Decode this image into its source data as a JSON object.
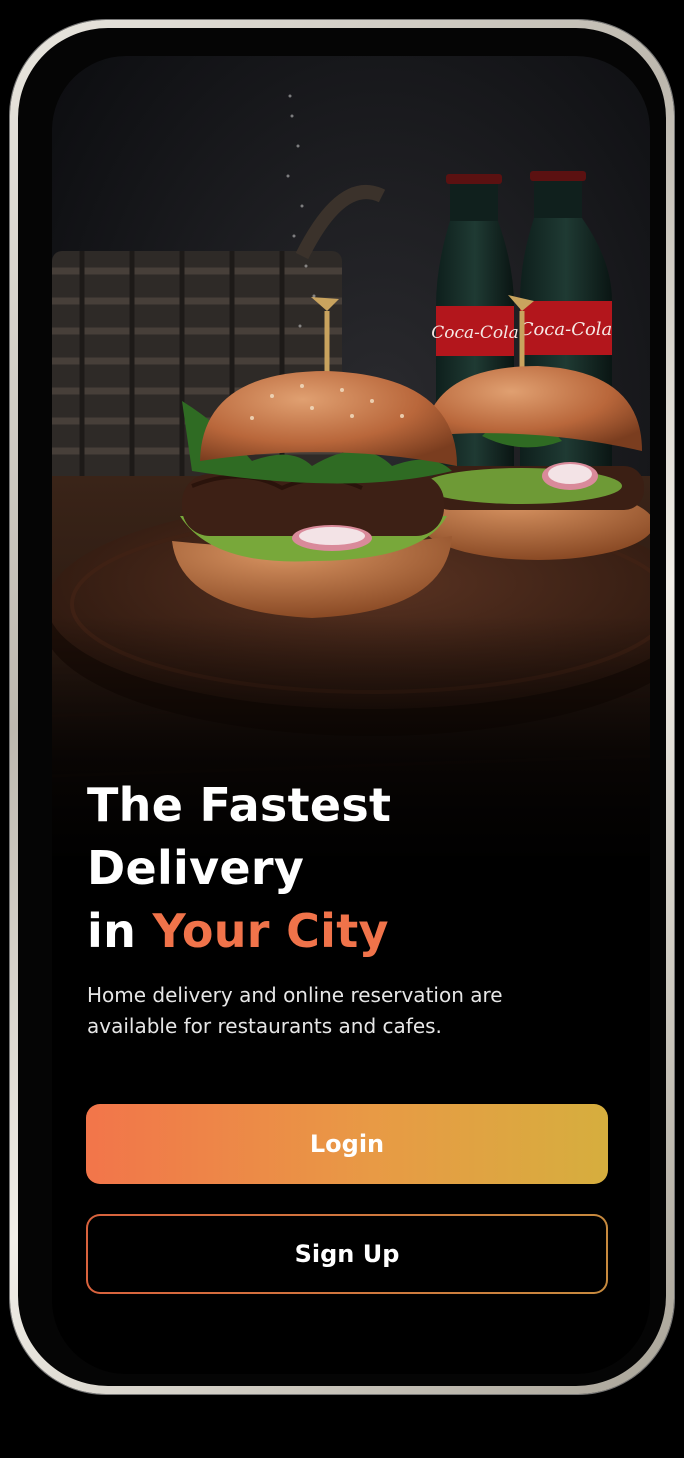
{
  "hero": {
    "image_description": ""
  },
  "headline": {
    "line1": "The Fastest",
    "line2": "Delivery",
    "line3_prefix": "in ",
    "line3_accent": "Your City"
  },
  "description": "Home delivery and online reservation are available for restaurants and cafes.",
  "buttons": {
    "login_label": "Login",
    "signup_label": "Sign Up"
  },
  "colors": {
    "accent": "#f0734a",
    "login_gradient_start": "#f2754a",
    "login_gradient_end": "#d6ae3e",
    "background": "#000000"
  }
}
